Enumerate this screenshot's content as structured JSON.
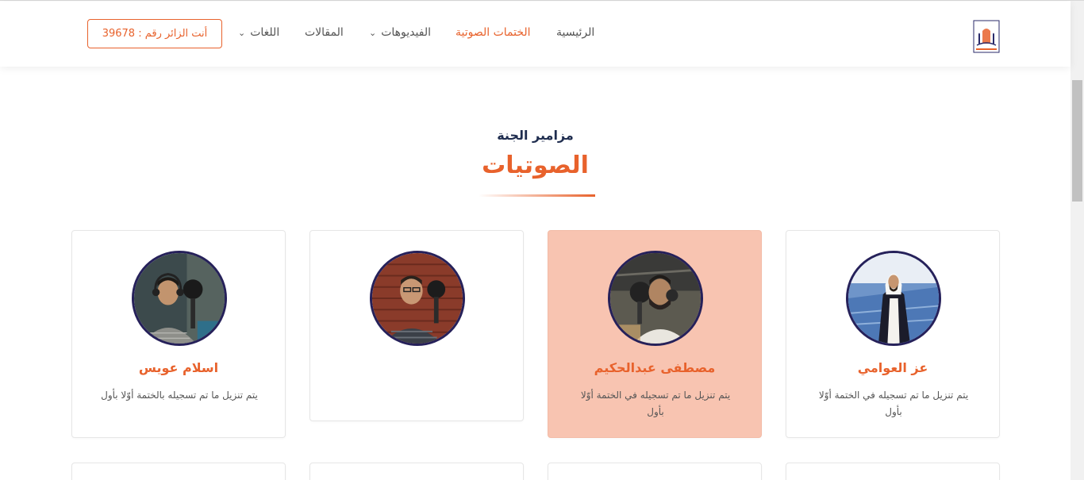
{
  "header": {
    "logo_alt": "site-logo",
    "nav": [
      {
        "label": "الرئيسية",
        "active": false,
        "dropdown": false
      },
      {
        "label": "الختمات الصوتية",
        "active": true,
        "dropdown": false
      },
      {
        "label": "الفيديوهات",
        "active": false,
        "dropdown": true
      },
      {
        "label": "المقالات",
        "active": false,
        "dropdown": false
      },
      {
        "label": "اللغات",
        "active": false,
        "dropdown": true
      }
    ],
    "visitor_label": "أنت الزائر رقم : 39678"
  },
  "section": {
    "subtitle": "مزامير الجنة",
    "title": "الصوتيات"
  },
  "cards": [
    {
      "name": "عز العوامي",
      "desc": "يتم تنزيل ما تم تسجيله في الختمة أوّلا بأول",
      "highlighted": false
    },
    {
      "name": "مصطفى عبدالحكيم",
      "desc": "يتم تنزيل ما تم تسجيله في الختمة أوّلا بأول",
      "highlighted": true
    },
    {
      "name": "",
      "desc": "",
      "highlighted": false
    },
    {
      "name": "اسلام عويس",
      "desc": "يتم تنزيل ما تم تسجيله بالختمة أوّلا بأول",
      "highlighted": false
    }
  ],
  "colors": {
    "accent": "#e8622c",
    "navy": "#1f2d4f",
    "highlight_card": "#f8c4b1",
    "avatar_border": "#26215a"
  }
}
